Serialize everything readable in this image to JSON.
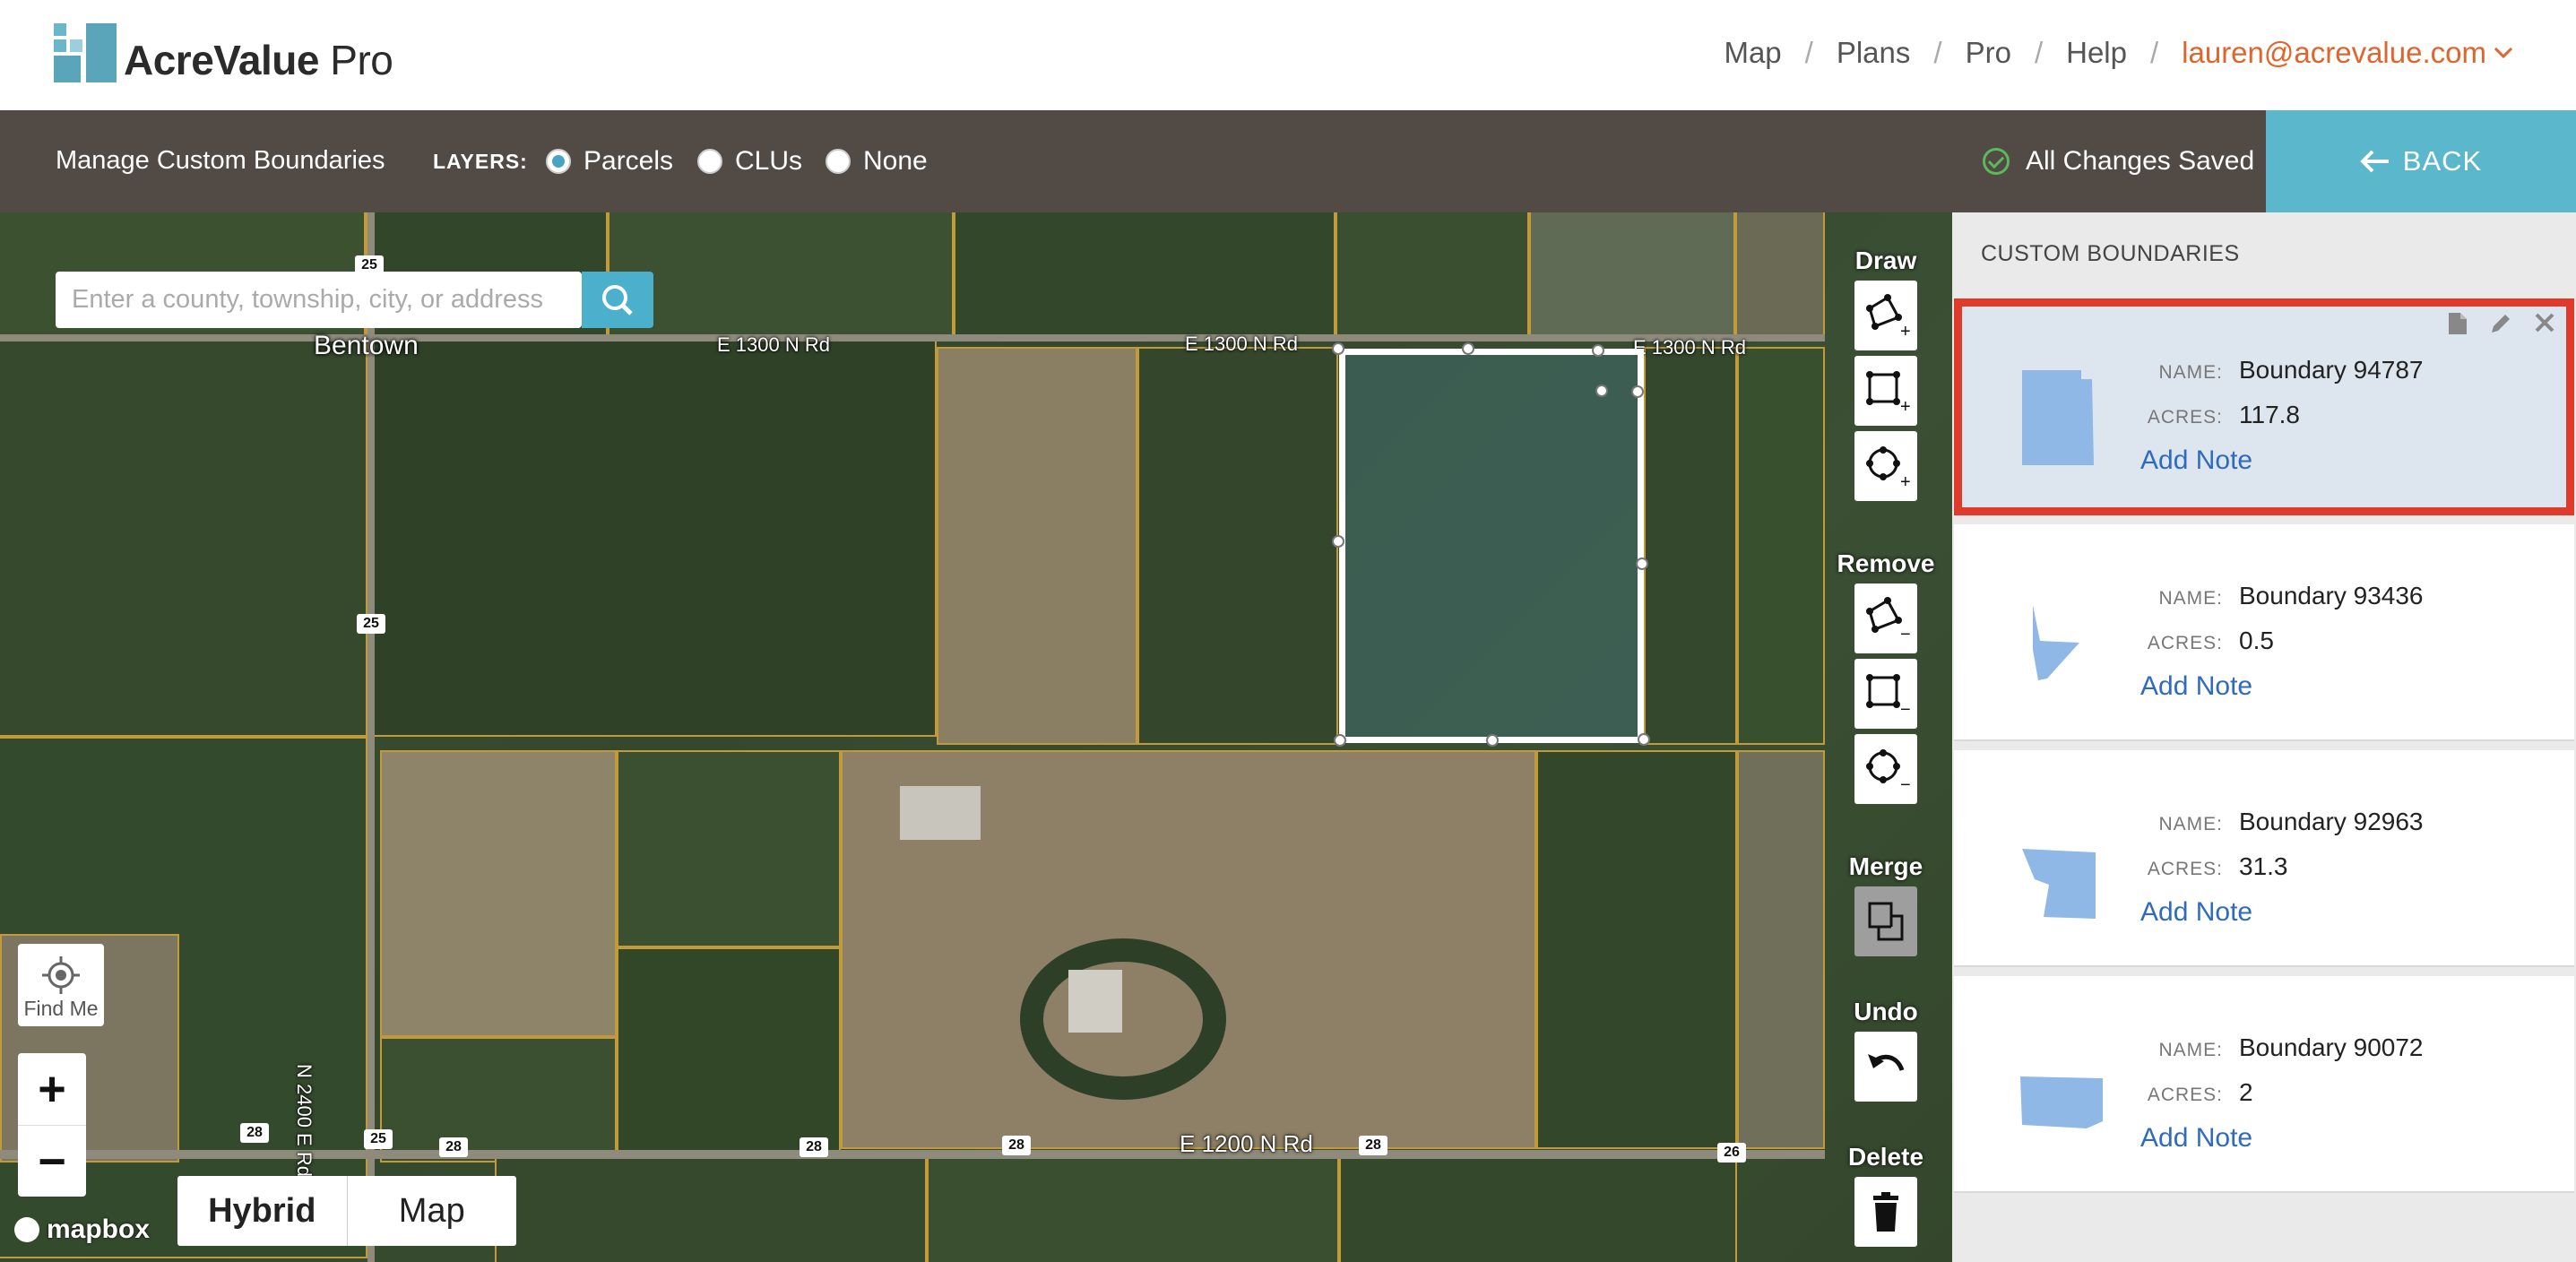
{
  "header": {
    "logo_text": "AcreValue",
    "logo_suffix": "Pro",
    "nav": [
      "Map",
      "Plans",
      "Pro",
      "Help"
    ],
    "separator": "/",
    "user_email": "lauren@acrevalue.com"
  },
  "toolbar": {
    "title": "Manage Custom Boundaries",
    "layers_label": "LAYERS:",
    "layers": [
      {
        "label": "Parcels",
        "selected": true
      },
      {
        "label": "CLUs",
        "selected": false
      },
      {
        "label": "None",
        "selected": false
      }
    ],
    "save_status": "All Changes Saved",
    "back_label": "BACK"
  },
  "map": {
    "search_placeholder": "Enter a county, township, city, or address",
    "town": "Bentown",
    "roads": [
      "E 1300 N Rd",
      "E 1300 N Rd",
      "E 1300 N Rd",
      "E 1200 N Rd",
      "N 2400 E Rd"
    ],
    "route_shields": [
      "25",
      "25",
      "25",
      "28",
      "28",
      "28",
      "28",
      "28",
      "28",
      "26"
    ],
    "find_me_label": "Find Me",
    "zoom_in": "+",
    "zoom_out": "−",
    "attribution": "mapbox",
    "styles": [
      "Hybrid",
      "Map"
    ],
    "active_style": "Hybrid"
  },
  "tools": {
    "draw_title": "Draw",
    "remove_title": "Remove",
    "merge_title": "Merge",
    "undo_title": "Undo",
    "delete_title": "Delete",
    "plus": "+",
    "minus": "−"
  },
  "sidebar": {
    "heading": "CUSTOM BOUNDARIES",
    "name_key": "NAME:",
    "acres_key": "ACRES:",
    "add_note": "Add Note",
    "boundaries": [
      {
        "name": "Boundary 94787",
        "acres": "117.8",
        "selected": true
      },
      {
        "name": "Boundary 93436",
        "acres": "0.5",
        "selected": false
      },
      {
        "name": "Boundary 92963",
        "acres": "31.3",
        "selected": false
      },
      {
        "name": "Boundary 90072",
        "acres": "2",
        "selected": false
      }
    ]
  },
  "colors": {
    "toolbar_bg": "#524a44",
    "accent_blue": "#5bb7cb",
    "user_orange": "#e0652d",
    "selected_outline": "#e03a2b",
    "link_blue": "#2e6bc0",
    "boundary_fill": "#8fb8e6",
    "parcel_line": "#c39a3a"
  },
  "icons": [
    "search-icon",
    "check-circle-icon",
    "arrow-left-icon",
    "chevron-down-icon",
    "locate-icon",
    "draw-polygon-icon",
    "draw-rectangle-icon",
    "draw-circle-icon",
    "remove-polygon-icon",
    "remove-rectangle-icon",
    "remove-circle-icon",
    "merge-icon",
    "undo-icon",
    "trash-icon",
    "document-icon",
    "pencil-icon",
    "close-icon"
  ]
}
